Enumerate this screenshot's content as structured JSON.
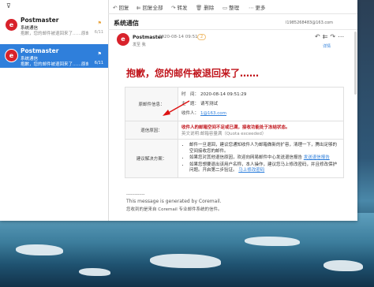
{
  "list": {
    "filter_icon": "filter-icon",
    "items": [
      {
        "avatar": "e",
        "sender": "Postmaster",
        "subject": "系统通信",
        "preview": "抱歉，您的邮件被退回来了……原邮...",
        "date": "6/11",
        "flag": "⚑"
      },
      {
        "avatar": "e",
        "sender": "Postmaster",
        "subject": "系统通信",
        "preview": "抱歉，您的邮件被退回来了……原邮...",
        "date": "6/11",
        "flag": "⚑"
      }
    ]
  },
  "toolbar": {
    "reply": "回复",
    "reply_all": "回复全部",
    "forward": "转发",
    "delete": "删除",
    "organize": "整理",
    "more": "更多"
  },
  "folder_title": "系统通信",
  "account": "l1985268483@163.com",
  "message": {
    "sender": "Postmaster",
    "date": "2020-08-14 09:51",
    "badge": "2",
    "sent_to": "发至 我",
    "details": "详情",
    "headline": "抱歉，您的邮件被退回来了……",
    "orig_label": "原邮件信息：",
    "time_key": "时　间：",
    "time_val": "2020-08-14 09:51:29",
    "subject_key": "主　题：",
    "subject_val": "请写测试",
    "recipient_key": "收件人：",
    "recipient_val": "1@163.com",
    "bounce_label": "退信原因：",
    "bounce_reason": "收件人的邮箱空间不足或已满，接收功能处于冻结状态。",
    "bounce_en": "英文说明:邮箱容量满（Quota exceeded）",
    "solution_label": "建议解决方案：",
    "suggestions": [
      "邮件一旦退回，建议您通知收件人为邮箱做新的扩容，清理一下，腾出足够的空间接收您的邮件。",
      "如果您对其他退信原因，欢迎向网易邮件中心发送退信报告",
      "如果您想要退出该用户名称，本人操作，建议您马上修改密码，并且修改保护问题。开启第二步验证。"
    ],
    "suggest_link1": "发送退信报告",
    "suggest_link2": "马上修改密码",
    "footer_dashes": "-------------",
    "footer_en": "This message is generated by Coremail.",
    "footer_cn": "您收到的是来自 Coremail 专业邮件系统的信件。"
  }
}
